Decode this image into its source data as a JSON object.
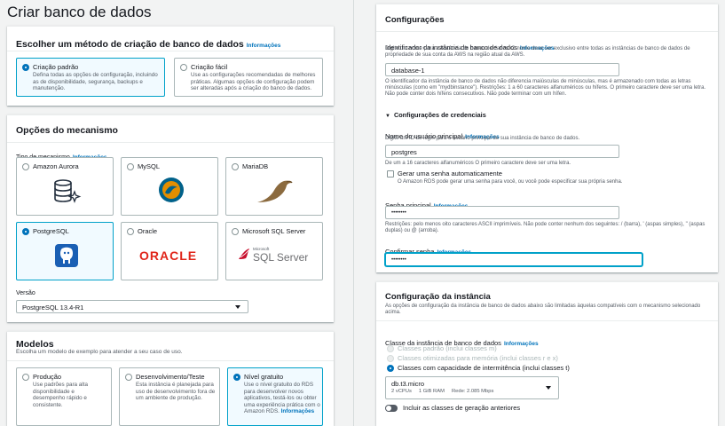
{
  "page": {
    "title": "Criar banco de dados"
  },
  "info_label": "Informações",
  "method": {
    "heading": "Escolher um método de criação de banco de dados",
    "info": "Informações",
    "options": [
      {
        "name": "Criação padrão",
        "desc": "Defina todas as opções de configuração, incluindo as de disponibilidade, segurança, backups e manutenção.",
        "selected": true
      },
      {
        "name": "Criação fácil",
        "desc": "Use as configurações recomendadas de melhores práticas. Algumas opções de configuração podem ser alteradas após a criação do banco de dados.",
        "selected": false
      }
    ]
  },
  "engine": {
    "heading": "Opções do mecanismo",
    "type_label": "Tipo de mecanismo",
    "info": "Informações",
    "options": [
      {
        "name": "Amazon Aurora",
        "icon": "aurora-icon",
        "selected": false
      },
      {
        "name": "MySQL",
        "icon": "mysql-icon",
        "selected": false
      },
      {
        "name": "MariaDB",
        "icon": "mariadb-icon",
        "selected": false
      },
      {
        "name": "PostgreSQL",
        "icon": "postgresql-icon",
        "selected": true
      },
      {
        "name": "Oracle",
        "icon": "oracle-logo",
        "selected": false,
        "logo_text": "ORACLE"
      },
      {
        "name": "Microsoft SQL Server",
        "icon": "sqlserver-logo",
        "selected": false,
        "logo_small": "Microsoft",
        "logo_text": "SQL Server"
      }
    ],
    "version_label": "Versão",
    "version_value": "PostgreSQL 13.4-R1"
  },
  "models": {
    "heading": "Modelos",
    "desc": "Escolha um modelo de exemplo para atender a seu caso de uso.",
    "options": [
      {
        "name": "Produção",
        "desc": "Use padrões para alta disponibilidade e desempenho rápido e consistente.",
        "selected": false
      },
      {
        "name": "Desenvolvimento/Teste",
        "desc": "Esta instância é planejada para uso de desenvolvimento fora de um ambiente de produção.",
        "selected": false
      },
      {
        "name": "Nível gratuito",
        "desc": "Use o nível gratuito do RDS para desenvolver novos aplicativos, testá-los ou obter uma experiência prática com o Amazon RDS.",
        "link": "Informações",
        "selected": true
      }
    ]
  },
  "config": {
    "heading": "Configurações",
    "instance_id_label": "Identificador da instância de banco de dados",
    "info": "Informações",
    "instance_id_desc": "Digite um nome para a instância de banco de dados. O nome deve ser exclusivo entre todas as instâncias de banco de dados de propriedade de sua conta da AWS na região atual da AWS.",
    "instance_id_value": "database-1",
    "instance_id_help": "O identificador da instância de banco de dados não diferencia maiúsculas de minúsculas, mas é armazenado com todas as letras minúsculas (como em \"mydbinstance\"). Restrições: 1 a 60 caracteres alfanuméricos ou hífens. O primeiro caractere deve ser uma letra. Não pode conter dois hífens consecutivos. Não pode terminar com um hífen.",
    "credentials_heading": "Configurações de credenciais",
    "username_label": "Nome do usuário principal",
    "username_desc": "Digite um ID de login para o usuário principal de sua instância de banco de dados.",
    "username_value": "postgres",
    "username_help": "De um a 16 caracteres alfanuméricos O primeiro caractere deve ser uma letra.",
    "autogen_label": "Gerar uma senha automaticamente",
    "autogen_desc": "O Amazon RDS pode gerar uma senha para você, ou você pode especificar sua própria senha.",
    "password_label": "Senha principal",
    "password_value": "••••••••",
    "password_help": "Restrições: pelo menos oito caracteres ASCII imprimíveis. Não pode conter nenhum dos seguintes: / (barra), ' (aspas simples), \" (aspas duplas) ou @ (arroba).",
    "confirm_label": "Confirmar senha",
    "confirm_value": "••••••••"
  },
  "instance": {
    "heading": "Configuração da instância",
    "desc": "As opções de configuração da instância de banco de dados abaixo são limitadas àquelas compatíveis com o mecanismo selecionado acima.",
    "class_label": "Classe da instância de banco de dados",
    "info": "Informações",
    "classes": [
      {
        "name": "Classes padrão (inclui classes m)",
        "disabled": true,
        "selected": false
      },
      {
        "name": "Classes otimizadas para memória (inclui classes r e x)",
        "disabled": true,
        "selected": false
      },
      {
        "name": "Classes com capacidade de intermitência (inclui classes t)",
        "disabled": false,
        "selected": true
      }
    ],
    "select_value": "db.t3.micro",
    "select_detail": "2 vCPUs     1 GiB RAM     Rede: 2.085 Mbps",
    "toggle_label": "Incluir as classes de geração anteriores"
  },
  "colors": {
    "accent": "#0073bb",
    "selected_border": "#00a1c9",
    "selected_bg": "#f1faff"
  }
}
